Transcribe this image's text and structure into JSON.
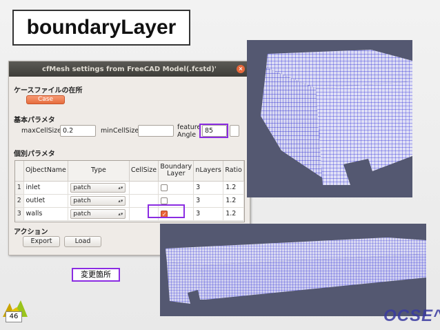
{
  "slide": {
    "title": "boundaryLayer",
    "page_number": "46",
    "note_label": "変更箇所",
    "brand": "OCSE^2"
  },
  "dialog": {
    "title": "cfMesh settings from FreeCAD Model(.fcstd)'",
    "close_glyph": "×",
    "case_section": "ケースファイルの在所",
    "case_button": "Case",
    "basic_section": "基本パラメタ",
    "max_cell_label": "maxCellSize",
    "max_cell_value": "0.2",
    "min_cell_label": "minCellSize",
    "min_cell_value": "",
    "feature_angle_label_1": "feature",
    "feature_angle_label_2": "Angle",
    "feature_angle_value": "85",
    "individual_section": "個別パラメタ",
    "columns": [
      "OjbectName",
      "Type",
      "CellSize",
      "Boundary Layer",
      "nLayers",
      "Ratio"
    ],
    "rows": [
      {
        "num": "1",
        "name": "inlet",
        "type": "patch",
        "cellsize": "",
        "boundary": false,
        "nlayers": "3",
        "ratio": "1.2"
      },
      {
        "num": "2",
        "name": "outlet",
        "type": "patch",
        "cellsize": "",
        "boundary": false,
        "nlayers": "3",
        "ratio": "1.2"
      },
      {
        "num": "3",
        "name": "walls",
        "type": "patch",
        "cellsize": "",
        "boundary": true,
        "nlayers": "3",
        "ratio": "1.2"
      }
    ],
    "action_section": "アクション",
    "export_button": "Export",
    "load_button": "Load"
  },
  "colors": {
    "highlight": "#8a2be2",
    "accent": "#e66d3e",
    "mesh_line": "#1a1ad0",
    "mesh_bg": "#545871"
  }
}
